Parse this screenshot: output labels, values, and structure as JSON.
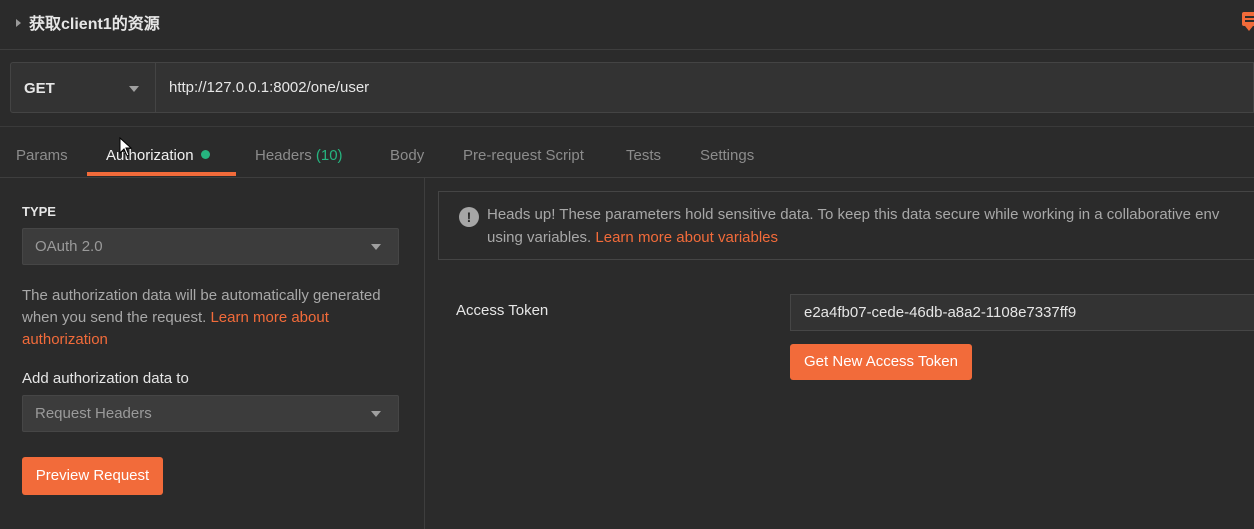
{
  "request": {
    "name": "获取client1的资源",
    "method": "GET",
    "url": "http://127.0.0.1:8002/one/user"
  },
  "tabs": [
    {
      "label": "Params"
    },
    {
      "label": "Authorization",
      "active": true,
      "indicator": "green-dot"
    },
    {
      "label": "Headers",
      "count": "(10)"
    },
    {
      "label": "Body"
    },
    {
      "label": "Pre-request Script"
    },
    {
      "label": "Tests"
    },
    {
      "label": "Settings"
    }
  ],
  "auth": {
    "type_label": "TYPE",
    "type_value": "OAuth 2.0",
    "description": "The authorization data will be automatically generated when you send the request.",
    "description_link": "Learn more about authorization",
    "add_to_label": "Add authorization data to",
    "add_to_value": "Request Headers",
    "preview_button": "Preview Request"
  },
  "notice": {
    "line1": "Heads up! These parameters hold sensitive data. To keep this data secure while working in a collaborative env",
    "line2_prefix": "using variables.",
    "line2_link": "Learn more about variables"
  },
  "token": {
    "label": "Access Token",
    "value": "e2a4fb07-cede-46db-a8a2-1108e7337ff9",
    "get_new_button": "Get New Access Token"
  },
  "colors": {
    "accent": "#f26b3a",
    "success": "#26b47f",
    "background": "#2b2b2b"
  }
}
